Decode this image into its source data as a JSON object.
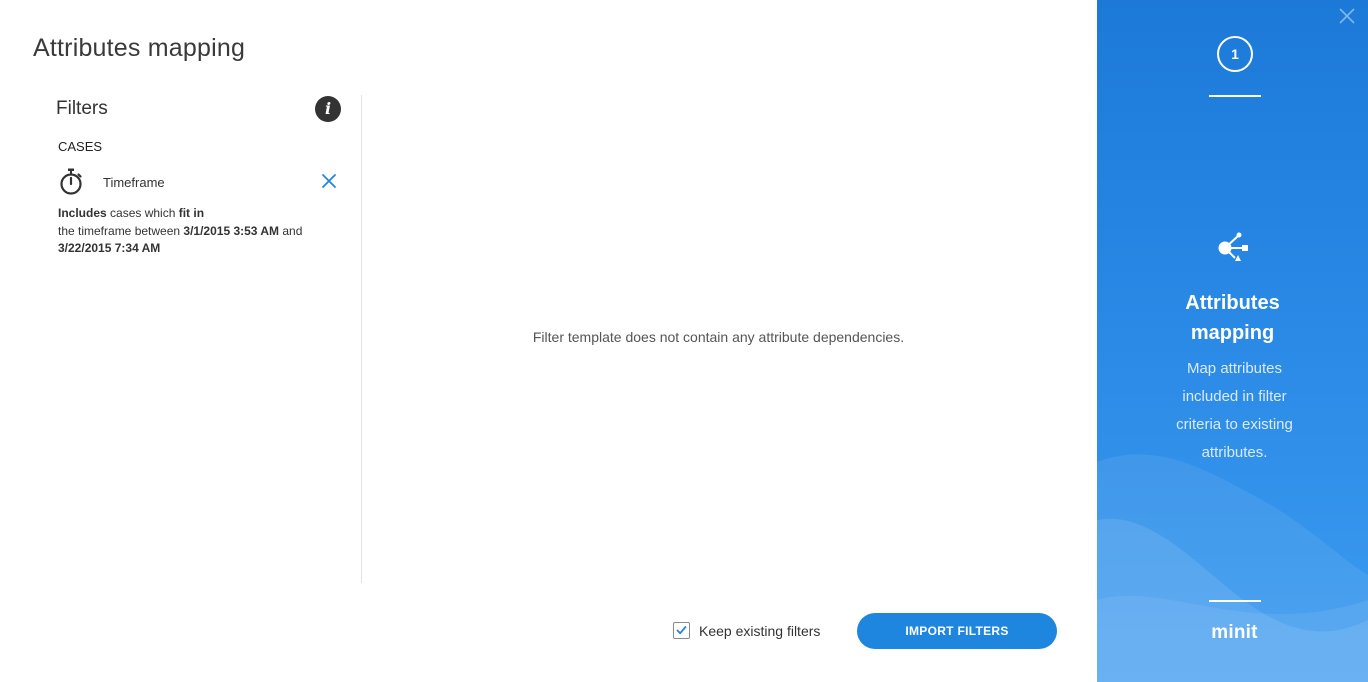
{
  "page": {
    "title": "Attributes mapping"
  },
  "filters": {
    "heading": "Filters",
    "info_icon_glyph": "i",
    "section_label": "CASES",
    "items": [
      {
        "icon": "stopwatch-icon",
        "label": "Timeframe",
        "remove_icon": "close-icon",
        "desc_includes": "Includes",
        "desc_cases_which": " cases which ",
        "desc_fit_in": "fit in",
        "desc_timeframe_between": "the timeframe between ",
        "desc_start": "3/1/2015 3:53 AM",
        "desc_and": " and",
        "desc_end": "3/22/2015 7:34 AM"
      }
    ]
  },
  "content": {
    "empty_message": "Filter template does not contain any attribute dependencies."
  },
  "footer": {
    "keep_existing_label": "Keep existing filters",
    "keep_existing_checked": true,
    "import_button_label": "IMPORT FILTERS",
    "accent_color": "#1f86e0"
  },
  "side_panel": {
    "step_number": "1",
    "icon": "share-mapping-icon",
    "title_line1": "Attributes",
    "title_line2": "mapping",
    "desc_lines": [
      "Map attributes",
      "included in filter",
      "criteria to existing",
      "attributes."
    ],
    "logo_text": "minit",
    "close_icon": "close-icon",
    "background_color": "#2a8ae6"
  }
}
